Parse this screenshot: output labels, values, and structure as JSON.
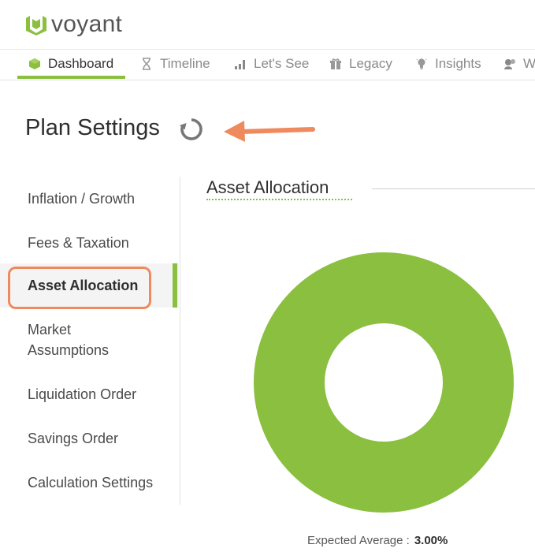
{
  "brand": {
    "name": "voyant",
    "color": "#8abf3f"
  },
  "nav": {
    "items": [
      {
        "label": "Dashboard",
        "icon": "cube-icon",
        "active": true
      },
      {
        "label": "Timeline",
        "icon": "hourglass-icon",
        "active": false
      },
      {
        "label": "Let's See",
        "icon": "bar-chart-icon",
        "active": false
      },
      {
        "label": "Legacy",
        "icon": "gift-icon",
        "active": false
      },
      {
        "label": "Insights",
        "icon": "lightbulb-icon",
        "active": false
      },
      {
        "label": "W",
        "icon": "person-chat-icon",
        "active": false
      }
    ]
  },
  "page": {
    "title": "Plan Settings"
  },
  "sidebar": {
    "items": [
      {
        "label": "Inflation / Growth"
      },
      {
        "label": "Fees & Taxation"
      },
      {
        "label": "Asset Allocation",
        "active": true
      },
      {
        "label": "Market"
      },
      {
        "label": "Assumptions"
      },
      {
        "label": "Liquidation Order"
      },
      {
        "label": "Savings Order"
      },
      {
        "label": "Calculation Settings"
      }
    ]
  },
  "main": {
    "section_title": "Asset Allocation",
    "expected_label": "Expected Average :",
    "expected_value": "3.00%"
  },
  "colors": {
    "accent": "#8abf3f",
    "annotation": "#ef8a5f"
  }
}
